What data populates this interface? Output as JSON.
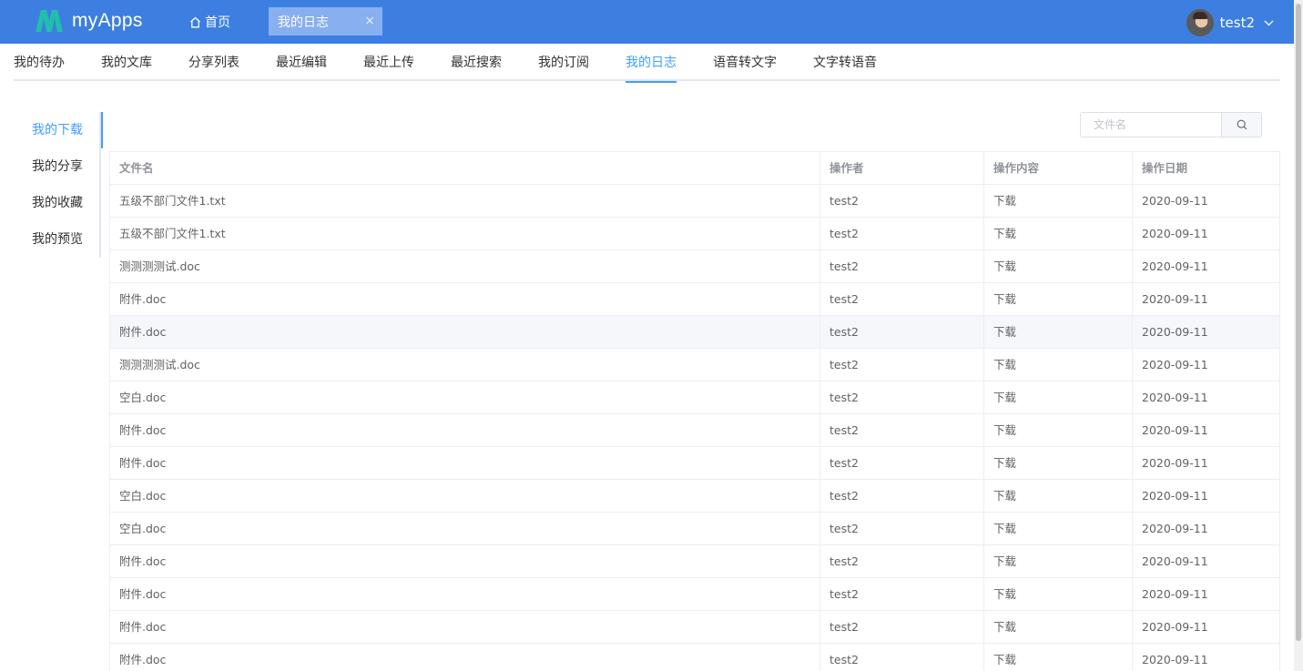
{
  "app": {
    "title": "myApps",
    "brand_color": "#3d7fe0",
    "logo_color": "#20c0a8"
  },
  "header": {
    "home_label": "首页",
    "active_tab_label": "我的日志",
    "close_icon": "×",
    "user_name": "test2"
  },
  "subnav": {
    "items": [
      "我的待办",
      "我的文库",
      "分享列表",
      "最近编辑",
      "最近上传",
      "最近搜索",
      "我的订阅",
      "我的日志",
      "语音转文字",
      "文字转语音"
    ],
    "active": "我的日志"
  },
  "sidetabs": {
    "items": [
      "我的下载",
      "我的分享",
      "我的收藏",
      "我的预览"
    ],
    "active": "我的下载"
  },
  "search": {
    "placeholder": "文件名"
  },
  "table": {
    "columns": [
      "文件名",
      "操作者",
      "操作内容",
      "操作日期"
    ],
    "rows": [
      [
        "五级不部门文件1.txt",
        "test2",
        "下载",
        "2020-09-11"
      ],
      [
        "五级不部门文件1.txt",
        "test2",
        "下载",
        "2020-09-11"
      ],
      [
        "测测测测试.doc",
        "test2",
        "下载",
        "2020-09-11"
      ],
      [
        "附件.doc",
        "test2",
        "下载",
        "2020-09-11"
      ],
      [
        "附件.doc",
        "test2",
        "下载",
        "2020-09-11"
      ],
      [
        "测测测测试.doc",
        "test2",
        "下载",
        "2020-09-11"
      ],
      [
        "空白.doc",
        "test2",
        "下载",
        "2020-09-11"
      ],
      [
        "附件.doc",
        "test2",
        "下载",
        "2020-09-11"
      ],
      [
        "附件.doc",
        "test2",
        "下载",
        "2020-09-11"
      ],
      [
        "空白.doc",
        "test2",
        "下载",
        "2020-09-11"
      ],
      [
        "空白.doc",
        "test2",
        "下载",
        "2020-09-11"
      ],
      [
        "附件.doc",
        "test2",
        "下载",
        "2020-09-11"
      ],
      [
        "附件.doc",
        "test2",
        "下载",
        "2020-09-11"
      ],
      [
        "附件.doc",
        "test2",
        "下载",
        "2020-09-11"
      ],
      [
        "附件.doc",
        "test2",
        "下载",
        "2020-09-11"
      ]
    ]
  }
}
